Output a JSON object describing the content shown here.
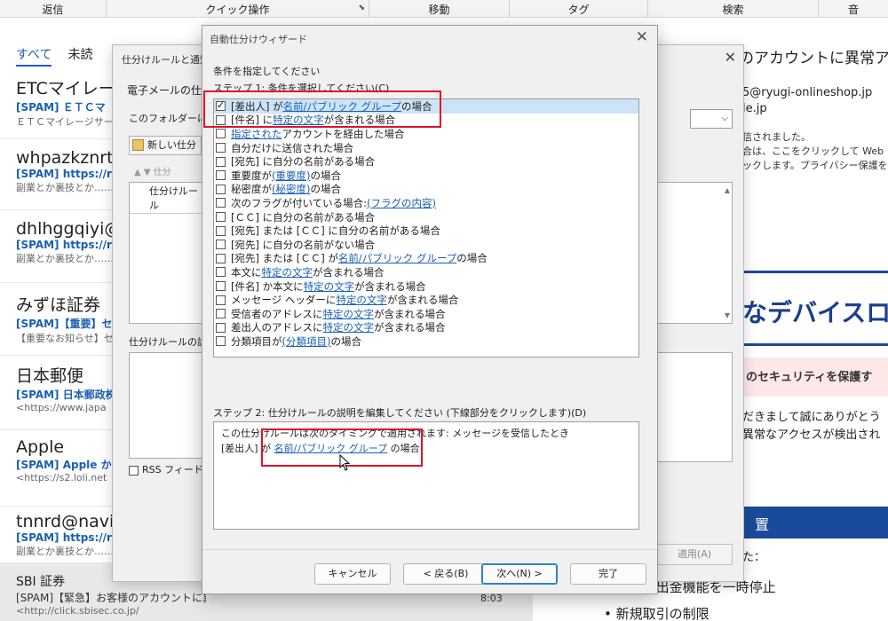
{
  "ribbon": {
    "groups": [
      "返信",
      "クイック操作",
      "移動",
      "タグ",
      "検索",
      "音"
    ]
  },
  "message_list": {
    "filter_all": "すべて",
    "filter_unread": "未読",
    "items": [
      {
        "sender": "ETCマイレージ",
        "subject": "[SPAM] ＥＴＣマ",
        "preview": "ＥＴＣマイレージサービ"
      },
      {
        "sender": "whpazkznrt",
        "subject": "[SPAM] https://r",
        "preview": "副業とか裏技とか…… そ"
      },
      {
        "sender": "dhlhggqiyi@",
        "subject": "[SPAM] https://r",
        "preview": "副業とか裏技とか…… そ"
      },
      {
        "sender": "みずほ証券",
        "subject": "[SPAM]【重要】セキ",
        "preview": "【重要なお知らせ】セキ"
      },
      {
        "sender": "日本郵便",
        "subject": "[SPAM] 日本郵政株",
        "preview": "<https://www.japa"
      },
      {
        "sender": "Apple",
        "subject": "[SPAM] Apple から",
        "preview": "<https://s2.loli.net"
      },
      {
        "sender": "tnnrd@navi",
        "subject": "[SPAM] https://r",
        "preview": "副業とか裏技とか…… そ"
      }
    ],
    "selected": {
      "sender": "SBI 証券",
      "subject": "[SPAM]【緊急】お客様のアカウントに異常アクセスを検出",
      "preview": "<http://click.sbisec.co.jp/",
      "time": "8:03"
    }
  },
  "reading_pane": {
    "subject": "のアカウントに異常アクセ",
    "address": "5@ryugi-onlineshop.jp",
    "address2": "le.jp",
    "info_lines": [
      "信されました。",
      "合は、ここをクリックして Web ブラウザ",
      "ックします。プライバシー保護を促進"
    ],
    "headline": "なデバイスロ",
    "pink_text": "のセキュリティを保護す",
    "body_lines": [
      "だきまして誠にありがとう",
      "異常なアクセスが検出され"
    ],
    "section_title": "置",
    "body2": "た：",
    "bullets": [
      "の出金機能を一時停止",
      "新規取引の制限"
    ]
  },
  "rules_dialog": {
    "title": "仕分けルールと通知",
    "tab": "電子メールの仕分",
    "folder_label": "このフォルダーに変",
    "new_rule": "新しい仕分",
    "rule_list_header": "仕分けルール",
    "desc_label": "仕分けルールの説",
    "rss_label": "RSS フィードか",
    "apply": "適用(A)",
    "sort_label": "仕分"
  },
  "wizard": {
    "title": "自動仕分けウィザード",
    "heading": "条件を指定してください",
    "step1_label": "ステップ 1: 条件を選択してください(C)",
    "conditions": [
      {
        "pre": "[差出人] が ",
        "link": "名前/パブリック グループ",
        "post": " の場合",
        "checked": true,
        "selected": true
      },
      {
        "pre": "[件名] に ",
        "link": "特定の文字",
        "post": " が含まれる場合",
        "checked": false
      },
      {
        "pre": "",
        "link": "指定された",
        "post": " アカウントを経由した場合",
        "checked": false
      },
      {
        "pre": "自分だけに送信された場合",
        "link": "",
        "post": "",
        "checked": false
      },
      {
        "pre": "[宛先] に自分の名前がある場合",
        "link": "",
        "post": "",
        "checked": false
      },
      {
        "pre": "重要度が ",
        "link": "(重要度)",
        "post": " の場合",
        "checked": false
      },
      {
        "pre": "秘密度が ",
        "link": "(秘密度)",
        "post": " の場合",
        "checked": false
      },
      {
        "pre": "次のフラグが付いている場合: ",
        "link": "(フラグの内容)",
        "post": "",
        "checked": false
      },
      {
        "pre": "[ＣＣ] に自分の名前がある場合",
        "link": "",
        "post": "",
        "checked": false
      },
      {
        "pre": "[宛先] または [ＣＣ] に自分の名前がある場合",
        "link": "",
        "post": "",
        "checked": false
      },
      {
        "pre": "[宛先] に自分の名前がない場合",
        "link": "",
        "post": "",
        "checked": false
      },
      {
        "pre": "[宛先] または [ＣＣ] が ",
        "link": "名前/パブリック グループ",
        "post": " の場合",
        "checked": false
      },
      {
        "pre": "本文に ",
        "link": "特定の文字",
        "post": " が含まれる場合",
        "checked": false
      },
      {
        "pre": "[件名] か本文に ",
        "link": "特定の文字",
        "post": " が含まれる場合",
        "checked": false
      },
      {
        "pre": "メッセージ ヘッダーに ",
        "link": "特定の文字",
        "post": " が含まれる場合",
        "checked": false
      },
      {
        "pre": "受信者のアドレスに ",
        "link": "特定の文字",
        "post": " が含まれる場合",
        "checked": false
      },
      {
        "pre": "差出人のアドレスに ",
        "link": "特定の文字",
        "post": " が含まれる場合",
        "checked": false
      },
      {
        "pre": "分類項目が ",
        "link": "(分類項目)",
        "post": " の場合",
        "checked": false
      }
    ],
    "step2_label": "ステップ 2: 仕分けルールの説明を編集してください (下線部分をクリックします)(D)",
    "desc_line1": "この仕分けルールは次のタイミングで適用されます: メッセージを受信したとき",
    "desc_line2_pre": "[差出人] が ",
    "desc_line2_link": "名前/パブリック グループ",
    "desc_line2_post": " の場合",
    "buttons": {
      "cancel": "キャンセル",
      "back": "< 戻る(B)",
      "next": "次へ(N) >",
      "finish": "完了"
    }
  }
}
